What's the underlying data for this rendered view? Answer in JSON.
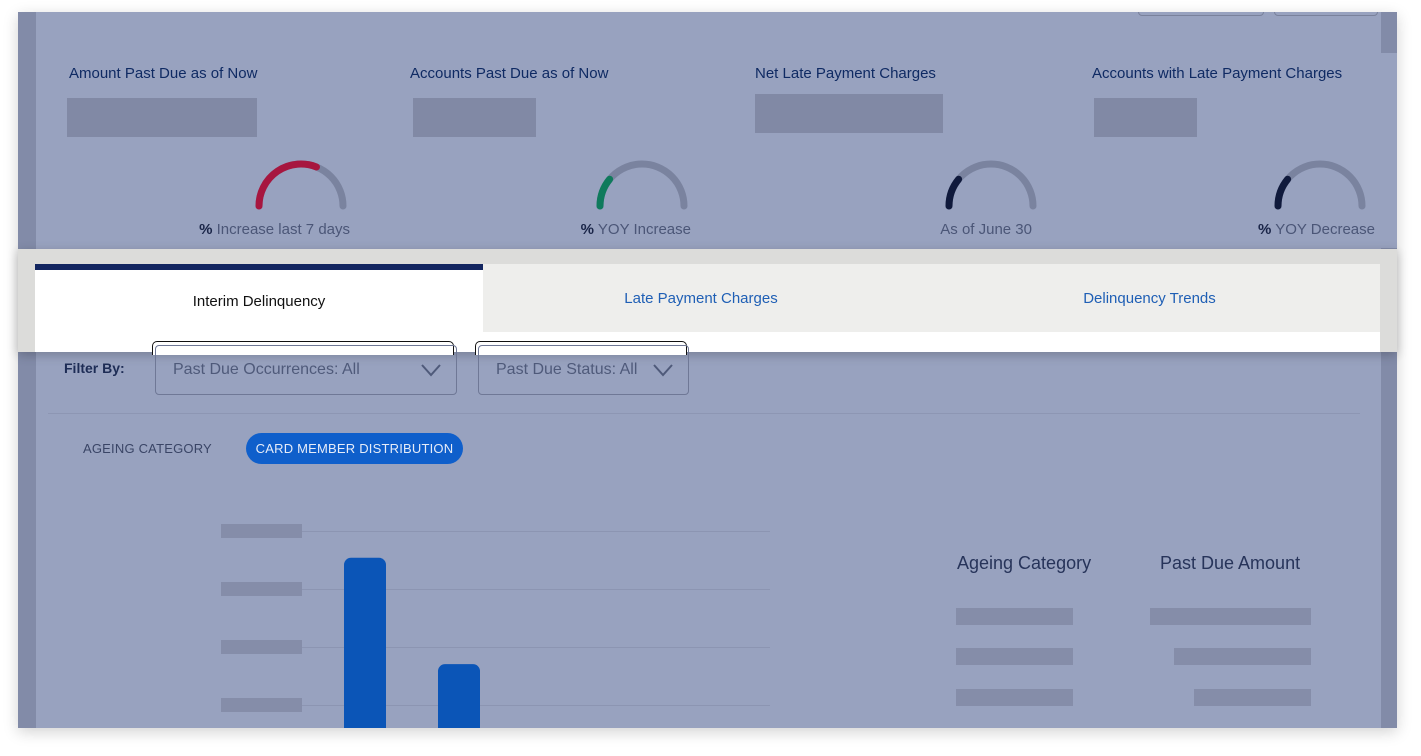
{
  "kpis": [
    {
      "title": "Amount Past Due as of Now",
      "foot_pct": "%",
      "foot_text": "Increase last 7 days",
      "gauge_fill": 0.62,
      "gauge_color": "#a7163f"
    },
    {
      "title": "Accounts Past Due as of Now",
      "foot_pct": "%",
      "foot_text": "YOY Increase",
      "gauge_fill": 0.22,
      "gauge_color": "#0f7a5c"
    },
    {
      "title": "Net Late Payment Charges",
      "foot_pct": "",
      "foot_text": "As of June 30",
      "gauge_fill": 0.22,
      "gauge_color": "#101a3c"
    },
    {
      "title": "Accounts with Late Payment Charges",
      "foot_pct": "%",
      "foot_text": "YOY Decrease",
      "gauge_fill": 0.22,
      "gauge_color": "#101a3c"
    }
  ],
  "tabs": [
    {
      "label": "Interim Delinquency",
      "active": true
    },
    {
      "label": "Late Payment Charges",
      "active": false
    },
    {
      "label": "Delinquency Trends",
      "active": false
    }
  ],
  "filters": {
    "label": "Filter By:",
    "occurrences": "Past Due Occurrences: All",
    "status": "Past Due Status: All"
  },
  "view_toggle": {
    "ageing": "AGEING CATEGORY",
    "distribution": "CARD MEMBER DISTRIBUTION"
  },
  "chart_data": {
    "type": "bar",
    "title": "",
    "categories": [
      "",
      ""
    ],
    "values": [
      0.8,
      0.3
    ],
    "ylim": [
      0,
      1
    ],
    "bar_color": "#0b55b7",
    "grid": true
  },
  "table": {
    "col1": "Ageing Category",
    "col2": "Past Due Amount"
  },
  "colors": {
    "accent": "#132660",
    "link": "#1f5fb5",
    "pill": "#0f5fcb"
  }
}
